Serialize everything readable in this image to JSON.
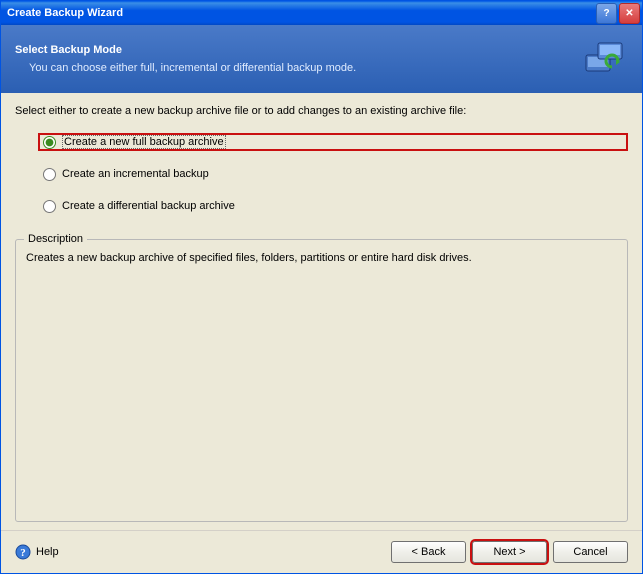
{
  "titlebar": {
    "title": "Create Backup Wizard"
  },
  "header": {
    "title": "Select Backup Mode",
    "subtitle": "You can choose either full, incremental or differential backup mode."
  },
  "instruction": "Select either to create a new backup archive file or to add changes to an existing archive file:",
  "options": [
    {
      "label": "Create a new full backup archive",
      "selected": true,
      "highlighted": true
    },
    {
      "label": "Create an incremental backup",
      "selected": false,
      "highlighted": false
    },
    {
      "label": "Create a differential backup archive",
      "selected": false,
      "highlighted": false
    }
  ],
  "description": {
    "legend": "Description",
    "text": "Creates a new backup archive of specified files, folders, partitions or entire hard disk drives."
  },
  "footer": {
    "help": "Help",
    "back": "< Back",
    "next": "Next >",
    "cancel": "Cancel"
  }
}
